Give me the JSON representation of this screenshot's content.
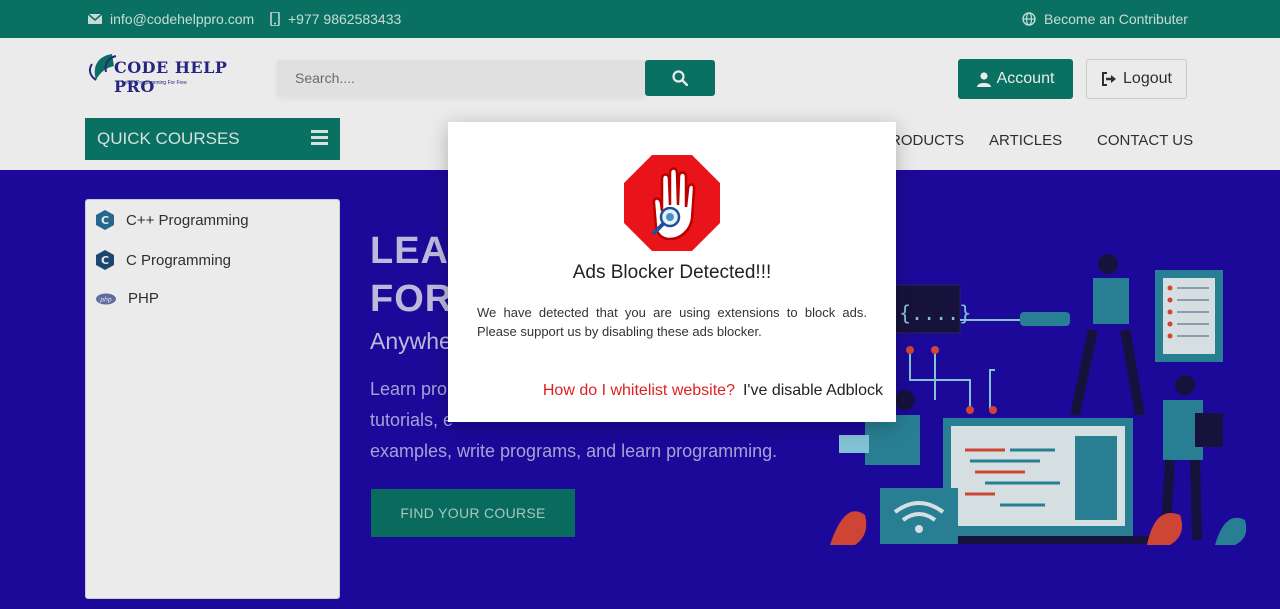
{
  "topbar": {
    "email": "info@codehelppro.com",
    "phone": "+977 9862583433",
    "contributor": "Become an Contributer",
    "icons": [
      "envelope-icon",
      "mobile-icon",
      "globe-icon"
    ]
  },
  "header": {
    "logo_text": "CODE HELP PRO",
    "logo_tagline": "Learn Programming For Free",
    "search_placeholder": "Search....",
    "account_label": "Account",
    "logout_label": "Logout"
  },
  "nav": {
    "quick_courses": "QUICK COURSES",
    "links": [
      "PRODUCTS",
      "ARTICLES",
      "CONTACT US"
    ]
  },
  "sidebar": {
    "items": [
      {
        "label": "C++ Programming",
        "icon": "cpp-icon"
      },
      {
        "label": "C Programming",
        "icon": "c-icon"
      },
      {
        "label": "PHP",
        "icon": "php-icon"
      }
    ]
  },
  "hero": {
    "line1": "LEA",
    "line2": "FOR",
    "sub": "Anywhe",
    "para_line1": "Learn pro",
    "para_line2": "tutorials, e",
    "para_line3": "examples, write programs, and learn programming.",
    "cta": "FIND YOUR COURSE"
  },
  "modal": {
    "title": "Ads Blocker Detected!!!",
    "text": "We have detected that you are using extensions to block ads. Please support us by disabling these ads blocker.",
    "link_whitelist": "How do I whitelist website?",
    "link_disabled": "I've disable Adblock"
  },
  "colors": {
    "brand": "#0b7a6b",
    "hero_bg": "#1f0aa6",
    "alert_red": "#e02020"
  }
}
